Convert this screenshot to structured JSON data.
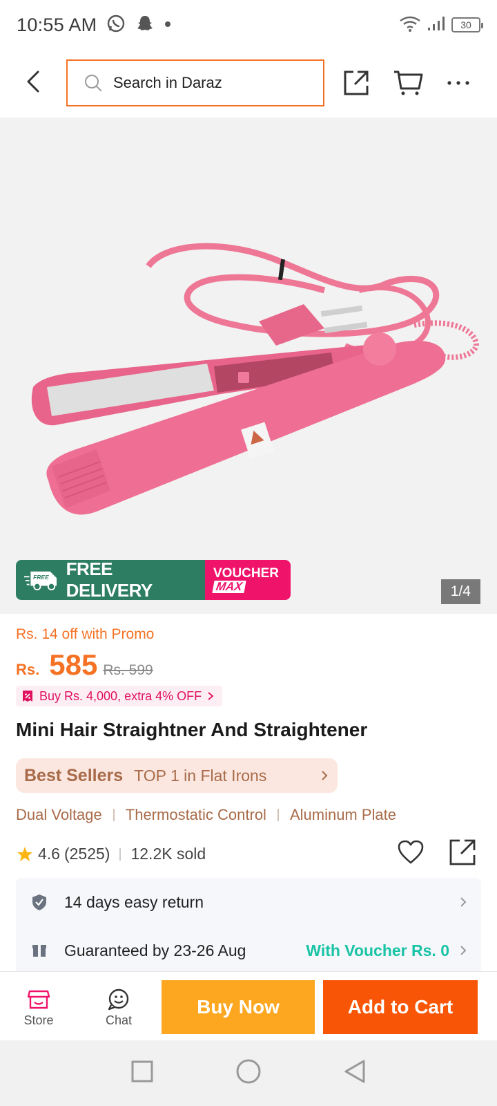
{
  "status_bar": {
    "time": "10:55 AM",
    "battery": "30"
  },
  "header": {
    "search_placeholder": "Search in Daraz"
  },
  "gallery": {
    "counter": "1/4",
    "badge_free": "FREE",
    "badge_free_delivery": "FREE DELIVERY",
    "badge_voucher": "VOUCHER",
    "badge_max": "MAX",
    "colors": {
      "product_pink": "#ee6f93",
      "background": "#f2f2f2"
    }
  },
  "price": {
    "promo": "Rs. 14 off with Promo",
    "currency": "Rs.",
    "current": "585",
    "original": "Rs. 599",
    "extra_off": "Buy Rs. 4,000, extra 4% OFF"
  },
  "product": {
    "title": "Mini Hair Straightner And Straightener"
  },
  "best_sellers": {
    "brand": "Best Sellers",
    "text": "TOP 1 in Flat Irons"
  },
  "features": [
    "Dual Voltage",
    "Thermostatic Control",
    "Aluminum Plate"
  ],
  "rating": {
    "score": "4.6",
    "count": "(2525)",
    "sold": "12.2K sold"
  },
  "info": {
    "returns": "14 days easy return",
    "delivery": "Guaranteed by 23-26 Aug",
    "voucher": "With Voucher Rs. 0"
  },
  "action_bar": {
    "store": "Store",
    "chat": "Chat",
    "buy_now": "Buy Now",
    "add_to_cart": "Add to Cart"
  },
  "theme": {
    "accent": "#f57224",
    "buy_now": "#fca71f",
    "add_to_cart": "#f85606",
    "free_delivery": "#2d7d62",
    "voucher": "#f0136a",
    "teal": "#19c3a6"
  }
}
